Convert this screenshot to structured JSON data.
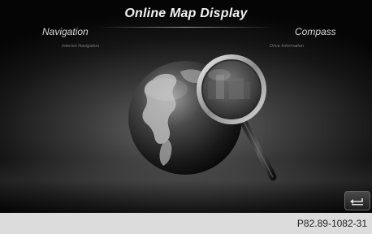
{
  "screen": {
    "title": "Online Map Display",
    "left_option": {
      "label": "Navigation",
      "sublabel": "Internet Navigation"
    },
    "right_option": {
      "label": "Compass",
      "sublabel": "Drive Information"
    }
  },
  "controls": {
    "back_icon": "back-arrow-icon"
  },
  "footer": {
    "reference_code": "P82.89-1082-31"
  }
}
